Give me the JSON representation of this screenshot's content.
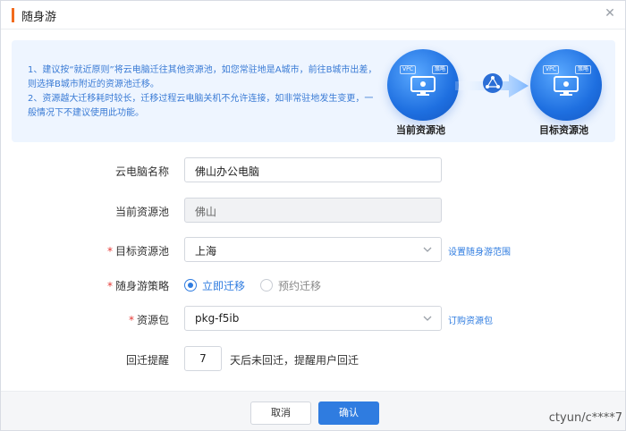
{
  "dialog": {
    "title": "随身游",
    "close_glyph": "✕"
  },
  "info": {
    "line1": "1、建议按“就近原则”将云电脑迁往其他资源池，如您常驻地是A城市，前往B城市出差，则选择B城市附近的资源池迁移。",
    "line2": "2、资源越大迁移耗时较长，迁移过程云电脑关机不允许连接，如非常驻地发生变更，一般情况下不建议使用此功能。",
    "current_pool": {
      "label": "当前资源池",
      "tag_left": "VPC",
      "tag_right": "策略"
    },
    "target_pool": {
      "label": "目标资源池",
      "tag_left": "VPC",
      "tag_right": "策略"
    }
  },
  "form": {
    "name": {
      "label": "云电脑名称",
      "value": "佛山办公电脑"
    },
    "current_pool": {
      "label": "当前资源池",
      "value": "佛山"
    },
    "target_pool": {
      "required": "*",
      "label": "目标资源池",
      "value": "上海",
      "link": "设置随身游范围"
    },
    "strategy": {
      "required": "*",
      "label": "随身游策略",
      "options": [
        "立即迁移",
        "预约迁移"
      ],
      "selected": 0
    },
    "package": {
      "required": "*",
      "label": "资源包",
      "value": "pkg-f5ib",
      "link": "订购资源包"
    },
    "reminder": {
      "label": "回迁提醒",
      "value": "7",
      "suffix": "天后未回迁，提醒用户回迁"
    }
  },
  "footer": {
    "cancel_label": "取消",
    "confirm_label": "确认"
  },
  "watermark": "ctyun/c****7",
  "colors": {
    "accent": "#2f7ce0",
    "title_bar": "#f26b1d",
    "required": "#e53935"
  }
}
